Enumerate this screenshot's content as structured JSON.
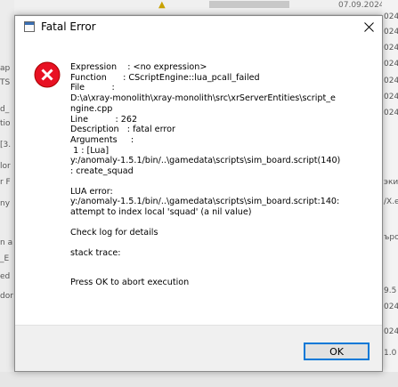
{
  "background": {
    "left_fragments": [
      "ap",
      "TS",
      "d_",
      "tio",
      "[3.",
      "lor",
      "r F",
      "ny",
      "n a",
      "_E",
      "ed",
      "dor"
    ],
    "right_fragments": [
      "024",
      "024",
      "024",
      "024",
      "024",
      "024",
      "024",
      "эки",
      "/X.e",
      "ърог",
      "9.5",
      "024",
      "024",
      "1.0"
    ],
    "top_date": "07.09.2024"
  },
  "dialog": {
    "title": "Fatal Error",
    "close_label": "×",
    "message_lines": [
      "Expression    : <no expression>",
      "Function      : CScriptEngine::lua_pcall_failed",
      "File          :",
      "D:\\a\\xray-monolith\\xray-monolith\\src\\xrServerEntities\\script_e",
      "ngine.cpp",
      "Line          : 262",
      "Description   : fatal error",
      "Arguments     :",
      " 1 : [Lua]",
      "y:/anomaly-1.5.1/bin/..\\gamedata\\scripts\\sim_board.script(140)",
      ": create_squad",
      "",
      "LUA error:",
      "y:/anomaly-1.5.1/bin/..\\gamedata\\scripts\\sim_board.script:140:",
      "attempt to index local 'squad' (a nil value)",
      "",
      "Check log for details",
      "",
      "stack trace:",
      "",
      "",
      "Press OK to abort execution"
    ],
    "ok_label": "OK"
  },
  "colors": {
    "error_red": "#e81123",
    "accent_blue": "#0078d7"
  }
}
